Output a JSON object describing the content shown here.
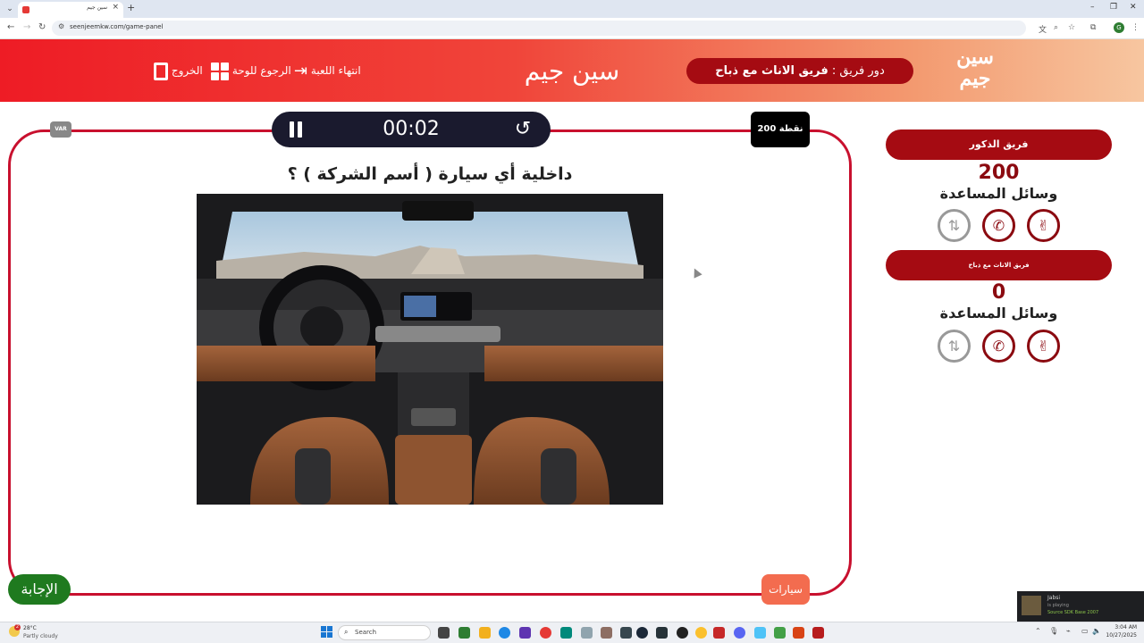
{
  "browser": {
    "tab_title": "سين جيم",
    "new_tab": "+",
    "tab_close": "×",
    "url": "seenjeemkw.com/game-panel",
    "minimize": "–",
    "restore": "❐",
    "close": "✕",
    "profile_initial": "G"
  },
  "header": {
    "logo_text": "سين جيم",
    "turn_prefix": "دور فريق :",
    "turn_team": "فريق الاناث مع ذباح",
    "center_title": "سين جيم",
    "end_game_label": "انتهاء اللعبة",
    "back_to_board_label": "الرجوع للوحة",
    "exit_label": "الخروج"
  },
  "game": {
    "var_badge": "VAR",
    "timer": "00:02",
    "points": "200 نقطة",
    "question": "داخلية أي سيارة ( أسم الشركة ) ؟",
    "answer_button": "الإجابة",
    "category_button": "سيارات"
  },
  "teams": [
    {
      "name": "فريق الذكور",
      "score": "200",
      "aids_title": "وسائل المساعدة"
    },
    {
      "name": "فريق الاناث مع ذباح",
      "score": "0",
      "aids_title": "وسائل المساعدة"
    }
  ],
  "steam": {
    "name": "Jabsi",
    "status": "is playing",
    "game": "Source SDK Base 2007"
  },
  "taskbar": {
    "temperature": "28°C",
    "weather": "Partly cloudy",
    "weather_badge": "2",
    "search_placeholder": "Search",
    "time": "3:04 AM",
    "date": "10/27/2025"
  },
  "colors": {
    "accent_red": "#a50b12",
    "board_border": "#c8102e",
    "answer_green": "#1f7a1f",
    "category_orange": "#f36c4f"
  }
}
